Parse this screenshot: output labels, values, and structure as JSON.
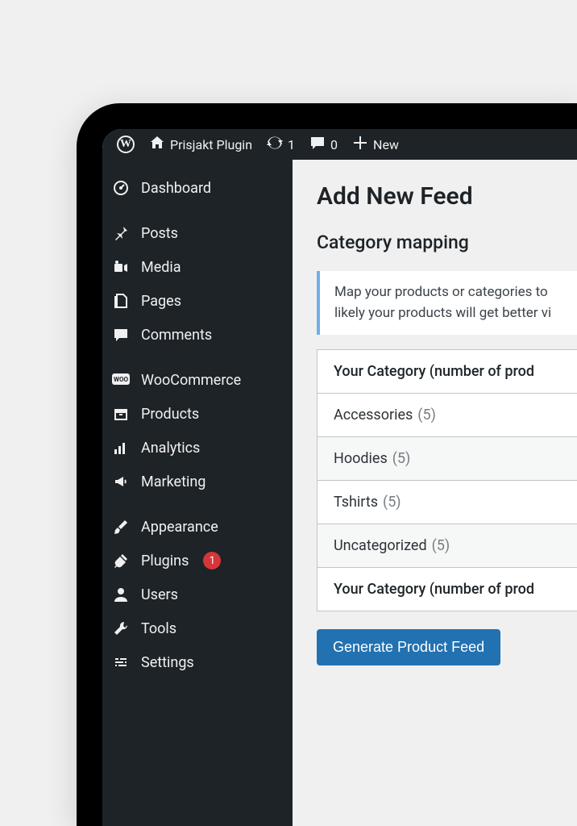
{
  "adminbar": {
    "site_name": "Prisjakt Plugin",
    "updates": "1",
    "comments": "0",
    "new_label": "New"
  },
  "sidebar": {
    "items": [
      {
        "label": "Dashboard",
        "icon": "dashboard"
      },
      {
        "label": "Posts",
        "icon": "pin",
        "sep_before": true
      },
      {
        "label": "Media",
        "icon": "media"
      },
      {
        "label": "Pages",
        "icon": "pages"
      },
      {
        "label": "Comments",
        "icon": "comment"
      },
      {
        "label": "WooCommerce",
        "icon": "woo",
        "sep_before": true
      },
      {
        "label": "Products",
        "icon": "archive"
      },
      {
        "label": "Analytics",
        "icon": "bars"
      },
      {
        "label": "Marketing",
        "icon": "megaphone"
      },
      {
        "label": "Appearance",
        "icon": "brush",
        "sep_before": true
      },
      {
        "label": "Plugins",
        "icon": "plug",
        "badge": "1"
      },
      {
        "label": "Users",
        "icon": "user"
      },
      {
        "label": "Tools",
        "icon": "wrench"
      },
      {
        "label": "Settings",
        "icon": "sliders"
      }
    ]
  },
  "page": {
    "title": "Add New Feed",
    "section": "Category mapping",
    "notice": "Map your products or categories to likely your products will get better vi",
    "table_header": "Your Category (number of prod",
    "table_footer": "Your Category (number of prod",
    "rows": [
      {
        "name": "Accessories",
        "count": "(5)"
      },
      {
        "name": "Hoodies",
        "count": "(5)"
      },
      {
        "name": "Tshirts",
        "count": "(5)"
      },
      {
        "name": "Uncategorized",
        "count": "(5)"
      }
    ],
    "button": "Generate Product Feed"
  }
}
